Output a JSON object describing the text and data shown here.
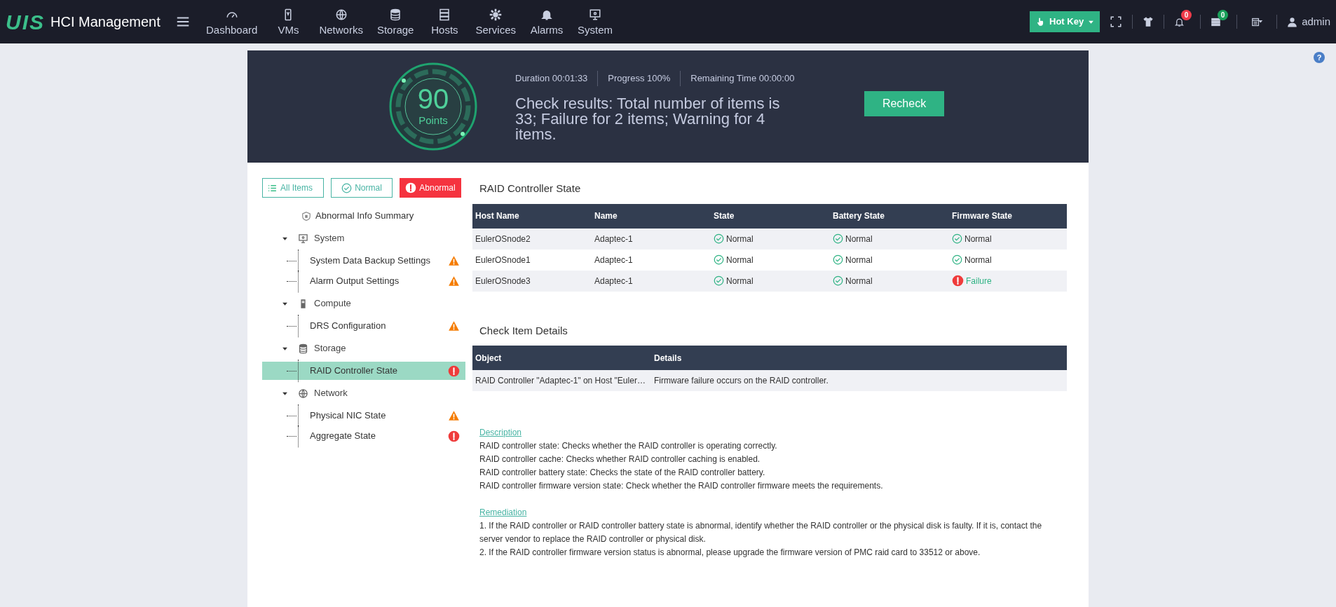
{
  "topbar": {
    "logo": "UIS",
    "title": "HCI Management",
    "nav": [
      {
        "label": "Dashboard"
      },
      {
        "label": "VMs"
      },
      {
        "label": "Networks"
      },
      {
        "label": "Storage"
      },
      {
        "label": "Hosts"
      },
      {
        "label": "Services"
      },
      {
        "label": "Alarms"
      },
      {
        "label": "System"
      }
    ],
    "hotkey": "Hot Key",
    "alarm_count": "0",
    "task_count": "0",
    "user": "admin",
    "help": "?"
  },
  "summary": {
    "score": "90",
    "score_unit": "Points",
    "stats": [
      "Duration 00:01:33",
      "Progress 100%",
      "Remaining Time 00:00:00"
    ],
    "result": "Check results: Total number of items is 33; Failure for 2 items; Warning for 4 items.",
    "recheck": "Recheck"
  },
  "filters": [
    {
      "label": "All Items",
      "kind": "all",
      "selected": false
    },
    {
      "label": "Normal",
      "kind": "normal",
      "selected": false
    },
    {
      "label": "Abnormal",
      "kind": "abnormal",
      "selected": true
    }
  ],
  "tree": [
    {
      "label": "Abnormal Info Summary",
      "kind": "summary"
    },
    {
      "label": "System",
      "kind": "group",
      "expanded": true,
      "children": [
        {
          "label": "System Data Backup Settings",
          "kind": "warning",
          "selected": false
        },
        {
          "label": "Alarm Output Settings",
          "kind": "warning",
          "selected": false
        }
      ]
    },
    {
      "label": "Compute",
      "kind": "group",
      "expanded": true,
      "children": [
        {
          "label": "DRS Configuration",
          "kind": "warning",
          "selected": false
        }
      ]
    },
    {
      "label": "Storage",
      "kind": "group",
      "expanded": true,
      "children": [
        {
          "label": "RAID Controller State",
          "kind": "error",
          "selected": true
        }
      ]
    },
    {
      "label": "Network",
      "kind": "group",
      "expanded": true,
      "children": [
        {
          "label": "Physical NIC State",
          "kind": "warning",
          "selected": false
        },
        {
          "label": "Aggregate State",
          "kind": "error",
          "selected": false
        }
      ]
    }
  ],
  "state_table": {
    "title": "RAID Controller State",
    "columns": [
      "Host Name",
      "Name",
      "State",
      "Battery State",
      "Firmware State"
    ],
    "rows": [
      [
        {
          "text": "EulerOSnode2"
        },
        {
          "text": "Adaptec-1"
        },
        {
          "text": "Normal",
          "kind": "ok"
        },
        {
          "text": "Normal",
          "kind": "ok"
        },
        {
          "text": "Normal",
          "kind": "ok"
        }
      ],
      [
        {
          "text": "EulerOSnode1"
        },
        {
          "text": "Adaptec-1"
        },
        {
          "text": "Normal",
          "kind": "ok"
        },
        {
          "text": "Normal",
          "kind": "ok"
        },
        {
          "text": "Normal",
          "kind": "ok"
        }
      ],
      [
        {
          "text": "EulerOSnode3"
        },
        {
          "text": "Adaptec-1"
        },
        {
          "text": "Normal",
          "kind": "ok"
        },
        {
          "text": "Normal",
          "kind": "ok"
        },
        {
          "text": "Failure",
          "kind": "failure"
        }
      ]
    ]
  },
  "details_table": {
    "title": "Check Item Details",
    "columns": [
      "Object",
      "Details"
    ],
    "rows": [
      [
        "RAID Controller \"Adaptec-1\" on Host \"Euler…",
        "Firmware failure occurs on the RAID controller."
      ]
    ]
  },
  "description": {
    "heading": "Description",
    "lines": [
      "RAID controller state: Checks whether the RAID controller is operating correctly.",
      "RAID controller cache: Checks whether RAID controller caching is enabled.",
      "RAID controller battery state: Checks the state of the RAID controller battery.",
      "RAID controller firmware version state: Check whether the RAID controller firmware meets the requirements."
    ]
  },
  "remediation": {
    "heading": "Remediation",
    "lines": [
      "1. If the RAID controller or RAID controller battery state is abnormal, identify whether the RAID controller or the physical disk is faulty. If it is, contact the server vendor to replace the RAID controller or physical disk.",
      "2. If the RAID controller firmware version status is abnormal, please upgrade the firmware version of PMC raid card to 33512 or above."
    ]
  }
}
